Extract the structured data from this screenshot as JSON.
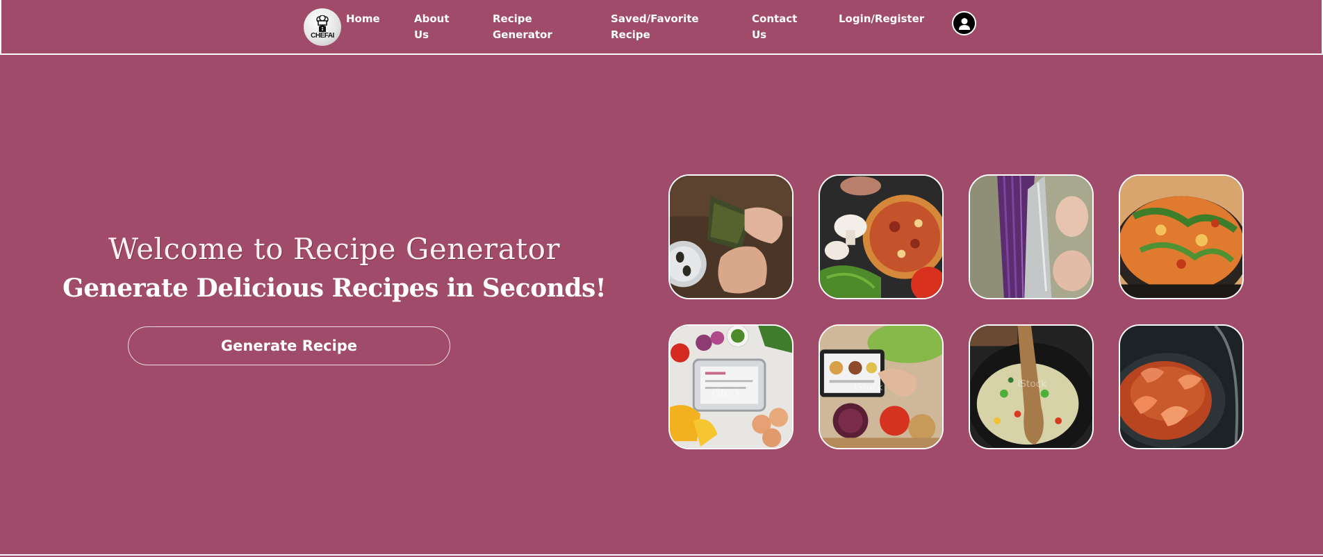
{
  "nav": {
    "logo_text": "CHEFAI",
    "links": [
      {
        "line1": "Home",
        "line2": ""
      },
      {
        "line1": "About",
        "line2": "Us"
      },
      {
        "line1": "Recipe",
        "line2": "Generator"
      },
      {
        "line1": "Saved/Favorite",
        "line2": "Recipe"
      },
      {
        "line1": "Contact",
        "line2": "Us"
      },
      {
        "line1": "Login/Register",
        "line2": ""
      }
    ],
    "avatar_icon": "user-icon"
  },
  "hero": {
    "title": "Welcome to Recipe Generator",
    "subtitle": "Generate Delicious Recipes in Seconds!",
    "button_label": "Generate Recipe"
  },
  "gallery": {
    "images": [
      {
        "name": "hands-wrapping-leaves-photo"
      },
      {
        "name": "pizza-mushrooms-photo"
      },
      {
        "name": "shredding-cabbage-photo"
      },
      {
        "name": "stir-fry-pan-photo"
      },
      {
        "name": "vegetables-tablet-photo"
      },
      {
        "name": "tablet-recipe-onions-photo"
      },
      {
        "name": "wok-vegetables-spoon-photo"
      },
      {
        "name": "shrimp-curry-pan-photo"
      }
    ]
  },
  "colors": {
    "background": "#a04b69",
    "text": "#ffffff",
    "border": "#ffffff"
  }
}
